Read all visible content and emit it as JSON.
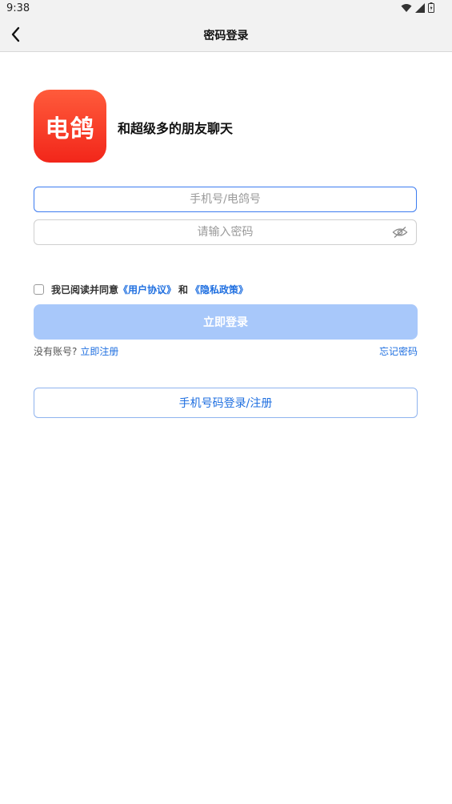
{
  "status_bar": {
    "time": "9:38"
  },
  "nav": {
    "title": "密码登录"
  },
  "brand": {
    "logo_text": "电鸽",
    "slogan": "和超级多的朋友聊天"
  },
  "form": {
    "phone_placeholder": "手机号/电鸽号",
    "password_placeholder": "请输入密码"
  },
  "agreement": {
    "prefix": "我已阅读并同意",
    "user_agreement": "《用户协议》",
    "and": "和",
    "privacy_policy": "《隐私政策》"
  },
  "actions": {
    "login": "立即登录",
    "no_account": "没有账号?",
    "register": "立即注册",
    "forgot": "忘记密码",
    "phone_login": "手机号码登录/注册"
  },
  "colors": {
    "accent": "#1f6fe0",
    "login_button_disabled": "#a8c8fa",
    "logo_gradient": [
      "#ff5b3b",
      "#f2261a"
    ]
  },
  "icons": {
    "back": "chevron-left-icon",
    "eye": "eye-off-icon",
    "wifi": "wifi-icon",
    "signal": "signal-icon",
    "battery": "battery-icon"
  }
}
